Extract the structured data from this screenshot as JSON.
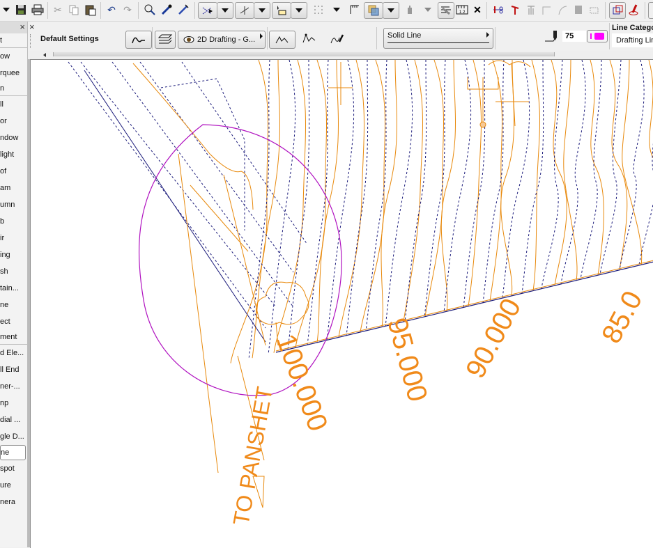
{
  "toolbar": {
    "buttons": [
      {
        "name": "menu-dropdown",
        "icon": "chevron-down-icon"
      },
      {
        "name": "save",
        "icon": "floppy-disk-icon"
      },
      {
        "name": "print",
        "icon": "printer-icon"
      },
      {
        "name": "cut",
        "icon": "scissors-icon"
      },
      {
        "name": "copy",
        "icon": "copy-icon"
      },
      {
        "name": "paste",
        "icon": "clipboard-icon"
      },
      {
        "name": "undo",
        "icon": "undo-icon"
      },
      {
        "name": "redo",
        "icon": "redo-icon"
      },
      {
        "name": "find-select",
        "icon": "find-select-icon"
      },
      {
        "name": "pick-up-parameters",
        "icon": "eyedropper-icon"
      },
      {
        "name": "inject-parameters",
        "icon": "syringe-icon"
      },
      {
        "name": "gravity",
        "icon": "snap-gravity-icon"
      },
      {
        "name": "trim",
        "icon": "trim-icon"
      },
      {
        "name": "selection-marquee",
        "icon": "marquee-icon"
      },
      {
        "name": "grid-snap",
        "icon": "grid-dots-icon"
      },
      {
        "name": "ruler",
        "icon": "ruler-icon"
      },
      {
        "name": "layers-overlap",
        "icon": "layers-icon"
      },
      {
        "name": "elevation",
        "icon": "elevation-icon"
      },
      {
        "name": "section-tools",
        "icon": "section-icon"
      },
      {
        "name": "dimension",
        "icon": "dimension-ruler-icon"
      },
      {
        "name": "close-x",
        "icon": "x-mark-icon"
      },
      {
        "name": "split",
        "icon": "split-icon"
      },
      {
        "name": "adjust",
        "icon": "adjust-icon"
      },
      {
        "name": "offset",
        "icon": "offset-icon"
      },
      {
        "name": "fillet",
        "icon": "fillet-corner-icon"
      },
      {
        "name": "arc",
        "icon": "arc-icon"
      },
      {
        "name": "explode",
        "icon": "explode-icon"
      },
      {
        "name": "resize",
        "icon": "resize-icon"
      },
      {
        "name": "edit-selection",
        "icon": "edit-selection-icon"
      },
      {
        "name": "pen-marker",
        "icon": "pen-marker-icon"
      }
    ]
  },
  "palette": {
    "close_label": "×",
    "items": [
      {
        "label": "t",
        "type": "category"
      },
      {
        "label": "ow"
      },
      {
        "label": "rquee"
      },
      {
        "label": "n",
        "type": "category"
      },
      {
        "label": "ll"
      },
      {
        "label": "or"
      },
      {
        "label": "ndow"
      },
      {
        "label": "light"
      },
      {
        "label": "of"
      },
      {
        "label": "am"
      },
      {
        "label": "umn"
      },
      {
        "label": "b"
      },
      {
        "label": "ir"
      },
      {
        "label": "ing"
      },
      {
        "label": "sh"
      },
      {
        "label": "tain..."
      },
      {
        "label": "ne"
      },
      {
        "label": "ect"
      },
      {
        "label": "ment",
        "type": "category"
      },
      {
        "label": "d Ele..."
      },
      {
        "label": "ll End"
      },
      {
        "label": "ner-..."
      },
      {
        "label": "np"
      },
      {
        "label": "dial ..."
      },
      {
        "label": "gle D..."
      },
      {
        "label": "ne",
        "selected": true
      },
      {
        "label": "spot"
      },
      {
        "label": "ure"
      },
      {
        "label": "nera"
      }
    ]
  },
  "info_box": {
    "close_label": "×",
    "title": "Default Settings",
    "layer_label": "2D Drafting - G...",
    "line_type": "Solid Line",
    "pen_number": "75",
    "pen_color": "#ff00ff",
    "line_category_label": "Line Catego",
    "line_category_value": "Drafting Lin"
  },
  "drawing": {
    "colors": {
      "contour": "#e8890c",
      "dashed": "#1a1a7a",
      "zone": "#b012c0",
      "label": "#f08a1a"
    },
    "contour_labels": [
      "100.000",
      "95.000",
      "90.000",
      "85.0"
    ],
    "annotation": "TO PANSHET"
  }
}
